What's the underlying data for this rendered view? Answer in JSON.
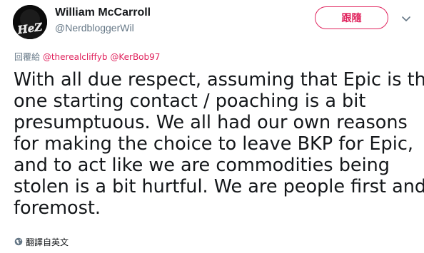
{
  "author": {
    "display_name": "William McCarroll",
    "handle": "@NerdbloggerWil",
    "avatar_text": "HeZ"
  },
  "header": {
    "follow_label": "跟隨",
    "more_icon": "chevron-down-icon"
  },
  "reply_to": {
    "prefix": "回覆給",
    "mention_1": "@therealcliffyb",
    "mention_2": "@KerBob97"
  },
  "tweet": {
    "lines": [
      "With all due respect, assuming that Epic is the",
      "one starting contact / poaching is a bit",
      "presumptuous. We all had our own reasons",
      "for making the choice to leave BKP for Epic,",
      "and to act like we are commodities being",
      "stolen is a bit hurtful. We are people first and",
      "foremost."
    ]
  },
  "translate": {
    "icon": "globe-icon",
    "label": "翻譯自英文"
  },
  "colors": {
    "accent": "#e0245e",
    "secondary_text": "#657786",
    "primary_text": "#14171a"
  }
}
